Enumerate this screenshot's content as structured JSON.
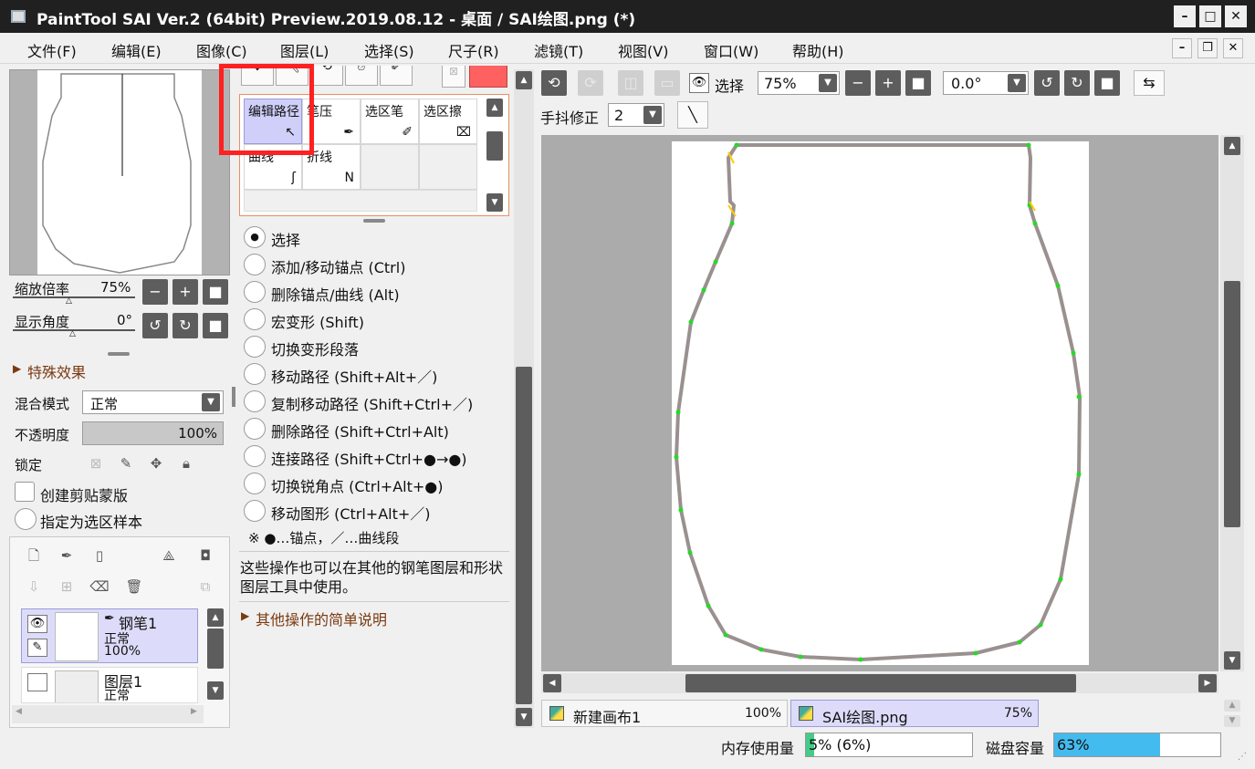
{
  "window": {
    "title": "PaintTool SAI Ver.2 (64bit) Preview.2019.08.12 - 桌面 / SAI绘图.png (*)",
    "min": "–",
    "max": "□",
    "close": "✕"
  },
  "menu": [
    {
      "label": "文件(F)"
    },
    {
      "label": "编辑(E)"
    },
    {
      "label": "图像(C)"
    },
    {
      "label": "图层(L)"
    },
    {
      "label": "选择(S)"
    },
    {
      "label": "尺子(R)"
    },
    {
      "label": "滤镜(T)"
    },
    {
      "label": "视图(V)"
    },
    {
      "label": "窗口(W)"
    },
    {
      "label": "帮助(H)"
    }
  ],
  "navigator": {
    "zoom_label": "缩放倍率",
    "zoom_value": "75%",
    "angle_label": "显示角度",
    "angle_value": "0°"
  },
  "layer_panel": {
    "effects": "特殊效果",
    "blend_label": "混合模式",
    "blend_value": "正常",
    "opacity_label": "不透明度",
    "opacity_value": "100%",
    "opacity_fraction": 1.0,
    "lock_label": "锁定",
    "clip_label": "创建剪贴蒙版",
    "selsrc_label": "指定为选区样本",
    "layers": [
      {
        "name": "钢笔1",
        "mode": "正常",
        "opacity": "100%"
      },
      {
        "name": "图层1",
        "mode": "正常"
      }
    ]
  },
  "tools": {
    "cells": [
      "编辑路径",
      "笔压",
      "选区笔",
      "选区擦",
      "曲线",
      "折线"
    ],
    "options": [
      "选择",
      "添加/移动锚点 (Ctrl)",
      "删除锚点/曲线 (Alt)",
      "宏变形 (Shift)",
      "切换变形段落",
      "移动路径 (Shift+Alt+／)",
      "复制移动路径 (Shift+Ctrl+／)",
      "删除路径 (Shift+Ctrl+Alt)",
      "连接路径 (Shift+Ctrl+●→●)",
      "切换锐角点 (Ctrl+Alt+●)",
      "移动图形 (Ctrl+Alt+／)"
    ],
    "legend": "※ ●…锚点，／…曲线段",
    "desc": "这些操作也可以在其他的钢笔图层和形状图层工具中使用。",
    "more": "其他操作的简单说明"
  },
  "toolbar": {
    "select_label": "选择",
    "zoom": "75%",
    "angle": "0.0°",
    "stab_label": "手抖修正",
    "stab_value": "2"
  },
  "canvas_tabs": [
    {
      "name": "新建画布1",
      "zoom": "100%"
    },
    {
      "name": "SAI绘图.png",
      "zoom": "75%"
    }
  ],
  "status": {
    "mem_label": "内存使用量",
    "mem_value": "5% (6%)",
    "mem_fraction": 0.05,
    "disk_label": "磁盘容量",
    "disk_value": "63%",
    "disk_fraction": 0.63
  },
  "colors": {
    "accent": "#cfcffa",
    "highlight_red": "#ff2020",
    "swatch": "#ff6060",
    "path_gray": "#9a9090",
    "anchor_green": "#22dd22",
    "bar_green": "#44cc88",
    "bar_blue": "#44bbee"
  }
}
